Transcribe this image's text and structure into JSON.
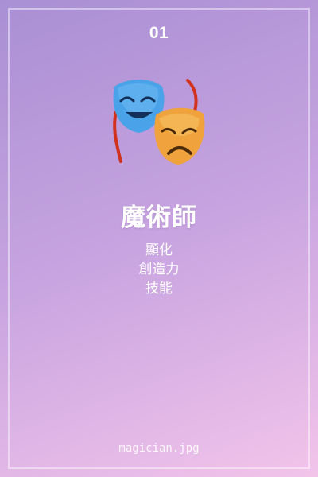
{
  "card": {
    "number": "01",
    "icon": "performing-arts-masks-icon",
    "title": "魔術師",
    "keywords": [
      "顯化",
      "創造力",
      "技能"
    ],
    "filename": "magician.jpg"
  },
  "colors": {
    "gradient_start": "#a98fd4",
    "gradient_end": "#f2c4ea",
    "text": "#ffffff",
    "comedy_mask": "#4aa3e8",
    "tragedy_mask": "#f0a23c",
    "ribbon": "#d0321e"
  }
}
